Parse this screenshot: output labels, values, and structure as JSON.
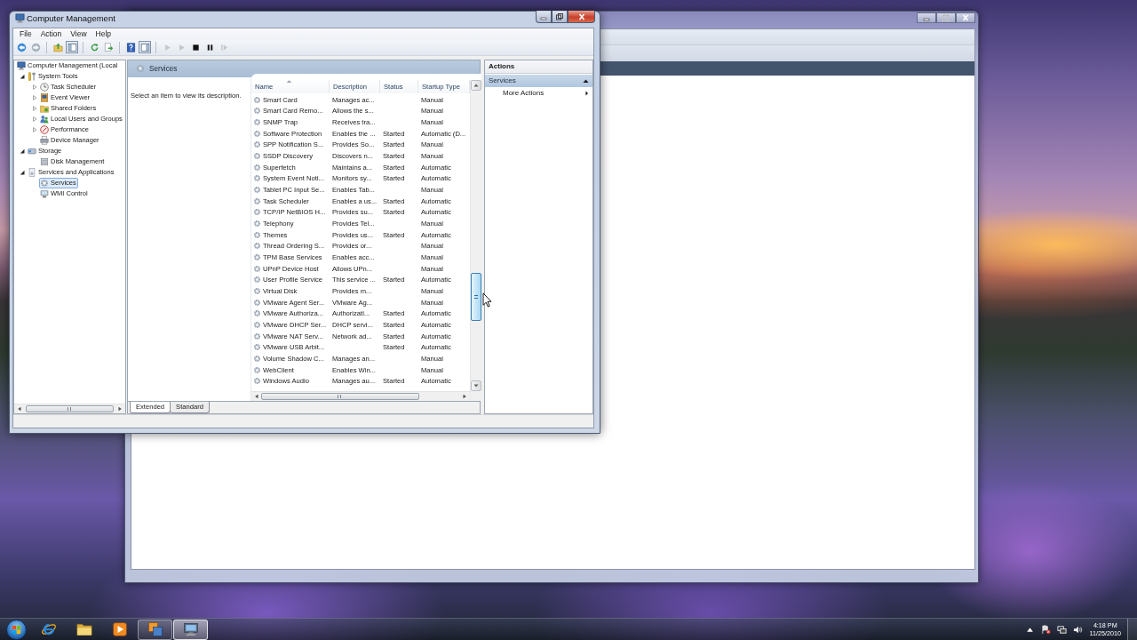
{
  "window": {
    "title": "Computer Management"
  },
  "menu": [
    "File",
    "Action",
    "View",
    "Help"
  ],
  "toolbar_groups": [
    {
      "buttons": [
        {
          "kind": "back",
          "pressed": false,
          "disabled": false
        },
        {
          "kind": "forward",
          "pressed": false,
          "disabled": true
        }
      ]
    },
    {
      "buttons": [
        {
          "kind": "up",
          "pressed": false,
          "disabled": false
        },
        {
          "kind": "tree",
          "pressed": true,
          "disabled": false
        }
      ]
    },
    {
      "buttons": [
        {
          "kind": "refresh",
          "pressed": false,
          "disabled": false
        },
        {
          "kind": "export",
          "pressed": false,
          "disabled": false
        }
      ]
    },
    {
      "buttons": [
        {
          "kind": "help",
          "pressed": false,
          "disabled": false
        },
        {
          "kind": "actionpane",
          "pressed": true,
          "disabled": false
        }
      ]
    },
    {
      "buttons": [
        {
          "kind": "play",
          "pressed": false,
          "disabled": true
        },
        {
          "kind": "play",
          "pressed": false,
          "disabled": true
        },
        {
          "kind": "stop",
          "pressed": false,
          "disabled": false
        },
        {
          "kind": "pause",
          "pressed": false,
          "disabled": false
        },
        {
          "kind": "resume",
          "pressed": false,
          "disabled": true
        }
      ]
    }
  ],
  "tree": [
    {
      "label": "Computer Management (Local",
      "kind": "computer",
      "selected": false,
      "children": [
        {
          "label": "System Tools",
          "kind": "tools",
          "expanded": true,
          "selected": false,
          "children": [
            {
              "label": "Task Scheduler",
              "kind": "clock",
              "expanded": false,
              "selected": false
            },
            {
              "label": "Event Viewer",
              "kind": "log",
              "expanded": false,
              "selected": false
            },
            {
              "label": "Shared Folders",
              "kind": "share",
              "expanded": false,
              "selected": false
            },
            {
              "label": "Local Users and Groups",
              "kind": "users",
              "expanded": false,
              "selected": false
            },
            {
              "label": "Performance",
              "kind": "gauge",
              "expanded": false,
              "selected": false
            },
            {
              "label": "Device Manager",
              "kind": "device",
              "selected": false
            }
          ]
        },
        {
          "label": "Storage",
          "kind": "drive",
          "expanded": true,
          "selected": false,
          "children": [
            {
              "label": "Disk Management",
              "kind": "disk",
              "selected": false
            }
          ]
        },
        {
          "label": "Services and Applications",
          "kind": "apps",
          "expanded": true,
          "selected": false,
          "children": [
            {
              "label": "Services",
              "kind": "gear",
              "selected": true
            },
            {
              "label": "WMI Control",
              "kind": "console",
              "selected": false
            }
          ]
        }
      ]
    }
  ],
  "services": {
    "title": "Services",
    "hint": "Select an item to view its description.",
    "columns": [
      {
        "label": "Name",
        "sorted": true
      },
      {
        "label": "Description",
        "sorted": false
      },
      {
        "label": "Status",
        "sorted": false
      },
      {
        "label": "Startup Type",
        "sorted": false
      }
    ],
    "rows": [
      {
        "name": "Smart Card",
        "description": "Manages ac...",
        "startup_type": "Manual"
      },
      {
        "name": "Smart Card Remo...",
        "description": "Allows the s...",
        "startup_type": "Manual"
      },
      {
        "name": "SNMP Trap",
        "description": "Receives tra...",
        "startup_type": "Manual"
      },
      {
        "name": "Software Protection",
        "description": "Enables the ...",
        "status": "Started",
        "startup_type": "Automatic (D..."
      },
      {
        "name": "SPP Notification S...",
        "description": "Provides So...",
        "status": "Started",
        "startup_type": "Manual"
      },
      {
        "name": "SSDP Discovery",
        "description": "Discovers n...",
        "status": "Started",
        "startup_type": "Manual"
      },
      {
        "name": "Superfetch",
        "description": "Maintains a...",
        "status": "Started",
        "startup_type": "Automatic"
      },
      {
        "name": "System Event Noti...",
        "description": "Monitors sy...",
        "status": "Started",
        "startup_type": "Automatic"
      },
      {
        "name": "Tablet PC Input Se...",
        "description": "Enables Tab...",
        "startup_type": "Manual"
      },
      {
        "name": "Task Scheduler",
        "description": "Enables a us...",
        "status": "Started",
        "startup_type": "Automatic"
      },
      {
        "name": "TCP/IP NetBIOS H...",
        "description": "Provides su...",
        "status": "Started",
        "startup_type": "Automatic"
      },
      {
        "name": "Telephony",
        "description": "Provides Tel...",
        "startup_type": "Manual"
      },
      {
        "name": "Themes",
        "description": "Provides us...",
        "status": "Started",
        "startup_type": "Automatic"
      },
      {
        "name": "Thread Ordering S...",
        "description": "Provides or...",
        "startup_type": "Manual"
      },
      {
        "name": "TPM Base Services",
        "description": "Enables acc...",
        "startup_type": "Manual"
      },
      {
        "name": "UPnP Device Host",
        "description": "Allows UPn...",
        "startup_type": "Manual"
      },
      {
        "name": "User Profile Service",
        "description": "This service ...",
        "status": "Started",
        "startup_type": "Automatic"
      },
      {
        "name": "Virtual Disk",
        "description": "Provides m...",
        "startup_type": "Manual"
      },
      {
        "name": "VMware Agent Ser...",
        "description": "VMware Ag...",
        "startup_type": "Manual"
      },
      {
        "name": "VMware Authoriza...",
        "description": "Authorizati...",
        "status": "Started",
        "startup_type": "Automatic"
      },
      {
        "name": "VMware DHCP Ser...",
        "description": "DHCP servi...",
        "status": "Started",
        "startup_type": "Automatic"
      },
      {
        "name": "VMware NAT Serv...",
        "description": "Network ad...",
        "status": "Started",
        "startup_type": "Automatic"
      },
      {
        "name": "VMware USB Arbit...",
        "status": "Started",
        "startup_type": "Automatic"
      },
      {
        "name": "Volume Shadow C...",
        "description": "Manages an...",
        "startup_type": "Manual"
      },
      {
        "name": "WebClient",
        "description": "Enables Win...",
        "startup_type": "Manual"
      },
      {
        "name": "Windows Audio",
        "description": "Manages au...",
        "status": "Started",
        "startup_type": "Automatic"
      }
    ]
  },
  "view_tabs": [
    {
      "label": "Extended",
      "selected": true
    },
    {
      "label": "Standard",
      "selected": false
    }
  ],
  "actions": {
    "title": "Actions",
    "sections": [
      {
        "label": "Services",
        "expanded": true,
        "items": [
          {
            "label": "More Actions",
            "submenu": true
          }
        ]
      }
    ]
  },
  "taskbar": {
    "items": [
      {
        "kind": "browser",
        "open": false,
        "selected": false
      },
      {
        "kind": "folder",
        "open": false,
        "selected": false
      },
      {
        "kind": "media",
        "open": false,
        "selected": false
      },
      {
        "kind": "squares",
        "open": true,
        "selected": false
      },
      {
        "kind": "console",
        "open": true,
        "selected": true
      }
    ],
    "time": "4:18 PM",
    "date": "11/25/2010"
  }
}
